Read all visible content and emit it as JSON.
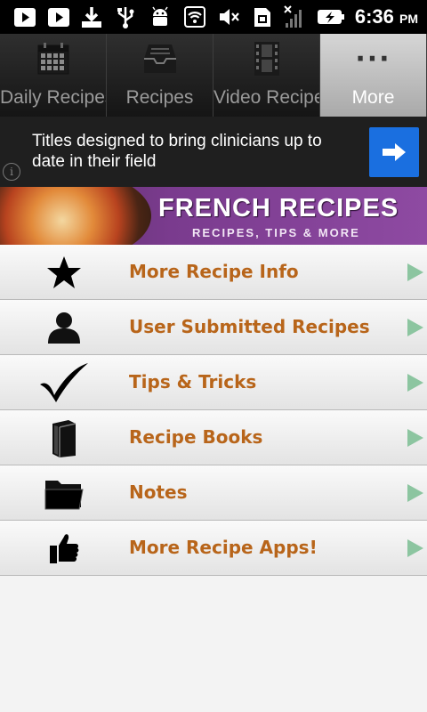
{
  "status_bar": {
    "icons": [
      "play-store-icon",
      "play-store-icon",
      "download-icon",
      "usb-icon",
      "android-debug-icon",
      "wifi-icon",
      "volume-muted-icon",
      "sim-card-icon",
      "signal-off-icon",
      "battery-charging-icon"
    ],
    "time": "6:36",
    "ampm": "PM"
  },
  "tabs": [
    {
      "label": "Daily Recipes",
      "icon": "calendar-icon"
    },
    {
      "label": "Recipes",
      "icon": "inbox-tray-icon"
    },
    {
      "label": "Video Recipe",
      "icon": "film-strip-icon"
    },
    {
      "label": "More",
      "icon": "more-dots-icon"
    }
  ],
  "more_dots": "···",
  "ad": {
    "text": "Titles designed to bring clinicians up to date in their field",
    "info": "i",
    "button_color": "#1a6fe0"
  },
  "banner": {
    "title": "FRENCH RECIPES",
    "subtitle": "RECIPES, TIPS & MORE"
  },
  "menu": [
    {
      "label": "More Recipe Info",
      "icon": "star-icon"
    },
    {
      "label": "User Submitted Recipes",
      "icon": "user-icon"
    },
    {
      "label": "Tips & Tricks",
      "icon": "checkmark-icon"
    },
    {
      "label": "Recipe Books",
      "icon": "book-icon"
    },
    {
      "label": "Notes",
      "icon": "folder-icon"
    },
    {
      "label": "More Recipe Apps!",
      "icon": "thumbs-up-icon"
    }
  ],
  "colors": {
    "menu_label": "#b8651a",
    "arrow": "#8cc5a0",
    "banner": "#7a3b8e"
  }
}
